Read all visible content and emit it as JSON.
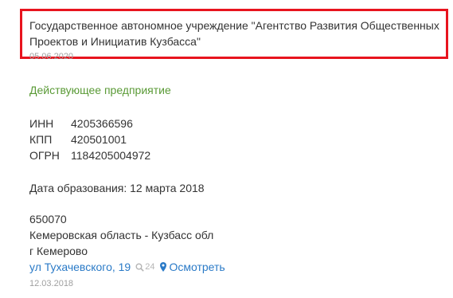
{
  "org": {
    "name": "Государственное автономное учреждение \"Агентство Развития Общественных Проектов и Инициатив Кузбасса\"",
    "date": "05.06.2020"
  },
  "status": "Действующее предприятие",
  "codes": [
    {
      "label": "ИНН",
      "value": "4205366596"
    },
    {
      "label": "КПП",
      "value": "420501001"
    },
    {
      "label": "ОГРН",
      "value": "1184205004972"
    }
  ],
  "founded": "Дата образования: 12 марта 2018",
  "address": {
    "postcode": "650070",
    "region": "Кемеровская область - Кузбасс обл",
    "city": "г Кемерово",
    "street": "ул Тухачевского, 19",
    "search_count": "24",
    "view_label": "Осмотреть",
    "date": "12.03.2018"
  },
  "colors": {
    "highlight": "#e8141e",
    "status": "#5a9a36",
    "link": "#2a7ac7",
    "muted": "#a0a0a0"
  },
  "icons": {
    "search_count": "search-icon",
    "view": "map-pin-icon"
  }
}
